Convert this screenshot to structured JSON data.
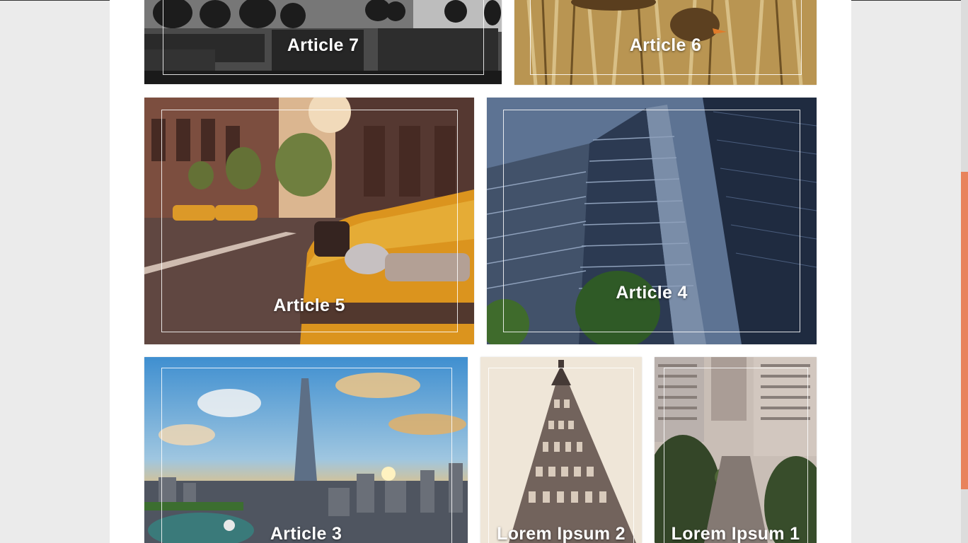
{
  "articles": [
    {
      "title": "Article 7"
    },
    {
      "title": "Article 6"
    },
    {
      "title": "Article 5"
    },
    {
      "title": "Article 4"
    },
    {
      "title": "Article 3"
    },
    {
      "title": "Lorem Ipsum 2"
    },
    {
      "title": "Lorem Ipsum 1"
    }
  ],
  "colors": {
    "accent": "#e8835c",
    "page_background": "#ebebeb",
    "content_background": "#ffffff"
  }
}
